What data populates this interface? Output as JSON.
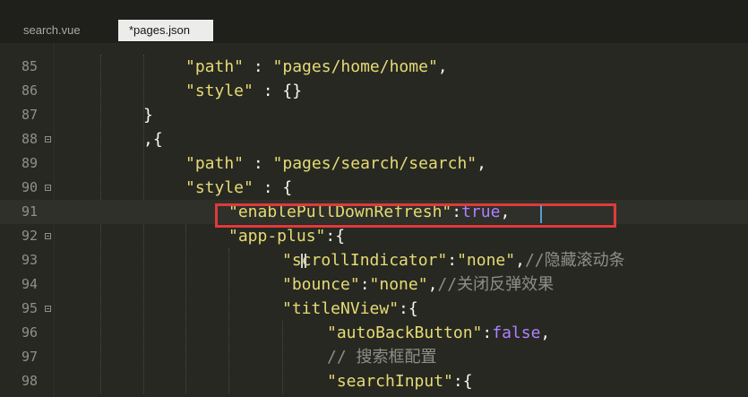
{
  "tabs": [
    {
      "label": "search.vue",
      "active": false
    },
    {
      "label": "*pages.json",
      "active": true
    }
  ],
  "lines": [
    {
      "num": "85",
      "tokens": [
        {
          "t": "s",
          "v": "\"path\""
        },
        {
          "t": "p",
          "v": " : "
        },
        {
          "t": "s",
          "v": "\"pages/home/home\""
        },
        {
          "t": "p",
          "v": ","
        }
      ]
    },
    {
      "num": "86",
      "tokens": [
        {
          "t": "s",
          "v": "\"style\""
        },
        {
          "t": "p",
          "v": " : {}"
        }
      ]
    },
    {
      "num": "87",
      "tokens": [
        {
          "t": "p",
          "v": "}"
        }
      ]
    },
    {
      "num": "88",
      "tokens": [
        {
          "t": "p",
          "v": ",{"
        }
      ]
    },
    {
      "num": "89",
      "tokens": [
        {
          "t": "s",
          "v": "\"path\""
        },
        {
          "t": "p",
          "v": " : "
        },
        {
          "t": "s",
          "v": "\"pages/search/search\""
        },
        {
          "t": "p",
          "v": ","
        }
      ]
    },
    {
      "num": "90",
      "tokens": [
        {
          "t": "s",
          "v": "\"style\""
        },
        {
          "t": "p",
          "v": " : {"
        }
      ]
    },
    {
      "num": "91",
      "tokens": [
        {
          "t": "s",
          "v": "\"enablePullDownRefresh\""
        },
        {
          "t": "p",
          "v": ":"
        },
        {
          "t": "k",
          "v": "true"
        },
        {
          "t": "p",
          "v": ","
        }
      ]
    },
    {
      "num": "92",
      "tokens": [
        {
          "t": "s",
          "v": "\"app-plus\""
        },
        {
          "t": "p",
          "v": ":{"
        }
      ]
    },
    {
      "num": "93",
      "tokens": [
        {
          "t": "s",
          "v": "\"scrollIndicator\""
        },
        {
          "t": "p",
          "v": ":"
        },
        {
          "t": "s",
          "v": "\"none\""
        },
        {
          "t": "p",
          "v": ","
        },
        {
          "t": "c",
          "v": "//隐藏滚动条"
        }
      ]
    },
    {
      "num": "94",
      "tokens": [
        {
          "t": "s",
          "v": "\"bounce\""
        },
        {
          "t": "p",
          "v": ":"
        },
        {
          "t": "s",
          "v": "\"none\""
        },
        {
          "t": "p",
          "v": ","
        },
        {
          "t": "c",
          "v": "//关闭反弹效果"
        }
      ]
    },
    {
      "num": "95",
      "tokens": [
        {
          "t": "s",
          "v": "\"titleNView\""
        },
        {
          "t": "p",
          "v": ":{"
        }
      ]
    },
    {
      "num": "96",
      "tokens": [
        {
          "t": "s",
          "v": "\"autoBackButton\""
        },
        {
          "t": "p",
          "v": ":"
        },
        {
          "t": "k",
          "v": "false"
        },
        {
          "t": "p",
          "v": ","
        }
      ]
    },
    {
      "num": "97",
      "tokens": [
        {
          "t": "c",
          "v": "// 搜索框配置"
        }
      ]
    },
    {
      "num": "98",
      "tokens": [
        {
          "t": "s",
          "v": "\"searchInput\""
        },
        {
          "t": "p",
          "v": ":{"
        }
      ]
    }
  ],
  "colors": {
    "background": "#272822",
    "string": "#e6db74",
    "keyword": "#ae81ff",
    "comment": "#8f8f86",
    "highlight_box": "#e03a3a"
  }
}
